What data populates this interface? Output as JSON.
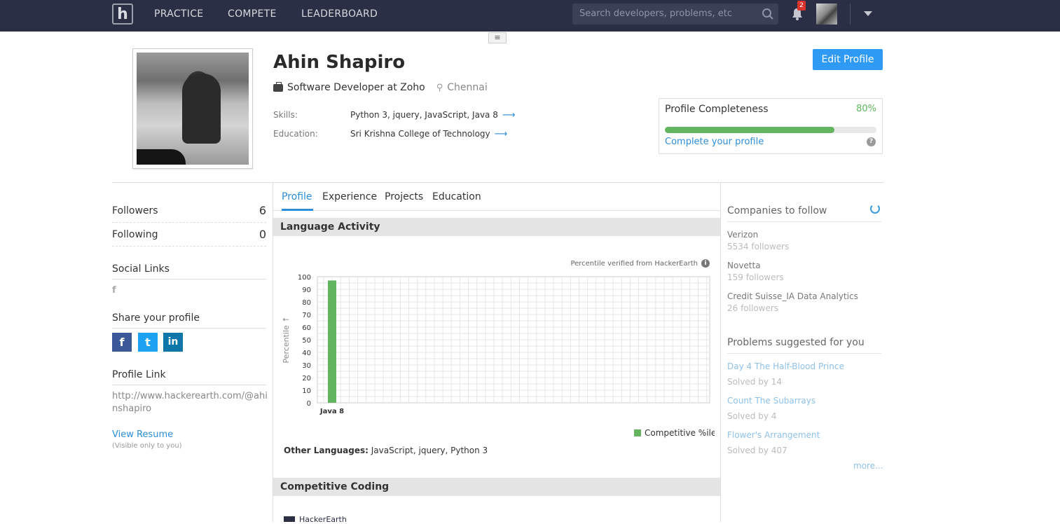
{
  "nav": {
    "logo": "h",
    "items": [
      "PRACTICE",
      "COMPETE",
      "LEADERBOARD"
    ],
    "search_placeholder": "Search developers, problems, etc",
    "notification_count": "2",
    "menu_glyph": "≡"
  },
  "profile": {
    "name": "Ahin Shapiro",
    "job": "Software Developer at Zoho",
    "location": "Chennai",
    "skills_label": "Skills:",
    "skills": "Python 3, jquery, JavaScript, Java 8",
    "education_label": "Education:",
    "education": "Sri Krishna College of Technology",
    "edit_button": "Edit Profile"
  },
  "completeness": {
    "title": "Profile Completeness",
    "percent_label": "80%",
    "percent": 0.8,
    "link": "Complete your profile"
  },
  "left": {
    "followers_label": "Followers",
    "followers": "6",
    "following_label": "Following",
    "following": "0",
    "social_links": "Social Links",
    "social_icon": "f",
    "share_title": "Share your profile",
    "share_buttons": [
      "f",
      "t",
      "in"
    ],
    "profile_link_title": "Profile Link",
    "profile_url": "http://www.hackerearth.com/@ahinshapiro",
    "view_resume": "View Resume",
    "resume_note": "(Visible only to you)"
  },
  "tabs": [
    "Profile",
    "Experience",
    "Projects",
    "Education"
  ],
  "language_activity": {
    "title": "Language Activity",
    "verified": "Percentile verified from HackerEarth",
    "other_label": "Other Languages:",
    "other_value": "JavaScript, jquery, Python 3"
  },
  "competitive_coding": {
    "title": "Competitive Coding",
    "brand": "HackerEarth"
  },
  "chart_data": {
    "type": "bar",
    "categories": [
      "Java 8"
    ],
    "series": [
      {
        "name": "Competitive %ile",
        "values": [
          97
        ]
      }
    ],
    "ylabel": "Percentile ↑",
    "ylim": [
      0,
      100
    ],
    "yticks": [
      0,
      10,
      20,
      30,
      40,
      50,
      60,
      70,
      80,
      90,
      100
    ],
    "grid": true,
    "legend": "bottom-right",
    "bar_color": "#62b45f"
  },
  "companies": {
    "title": "Companies to follow",
    "items": [
      {
        "name": "Verizon",
        "followers": "5534 followers"
      },
      {
        "name": "Novetta",
        "followers": "159 followers"
      },
      {
        "name": "Credit Suisse_IA Data Analytics",
        "followers": "26 followers"
      }
    ]
  },
  "problems": {
    "title": "Problems suggested for you",
    "items": [
      {
        "name": "Day 4 The Half-Blood Prince",
        "solved": "Solved by 14"
      },
      {
        "name": "Count The Subarrays",
        "solved": "Solved by 4"
      },
      {
        "name": "Flower's Arrangement",
        "solved": "Solved by 407"
      }
    ],
    "more": "more..."
  },
  "colors": {
    "topbar": "#2b2f45",
    "accent": "#2e9af4",
    "success": "#5cb85c",
    "facebook": "#3b5998",
    "twitter": "#1da1f2",
    "linkedin": "#0e76a8"
  }
}
